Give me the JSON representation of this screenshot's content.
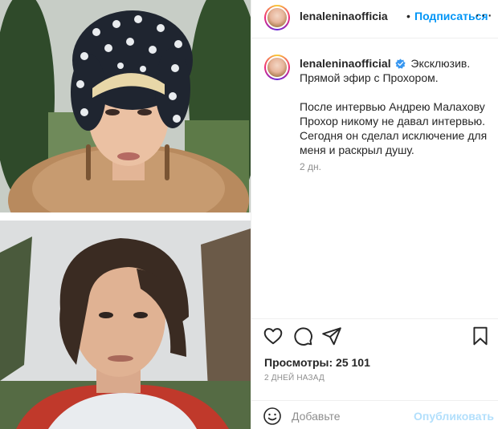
{
  "post": {
    "media_top_alt": "woman in polka-dot turban and fur coat",
    "media_bottom_alt": "man with dark fringe hair outdoors"
  },
  "header": {
    "username": "lenaleninaofficia",
    "dot": "•",
    "follow_label": "Подписаться",
    "more_label": "···"
  },
  "caption": {
    "username": "lenaleninaofficial",
    "line1": "Эксклюзив.",
    "line2": "Прямой эфир с Прохором.",
    "para2_line1": "После интервью Андрею Малахову",
    "para2_line2": "Прохор никому не давал интервью.",
    "para2_line3": "Сегодня он сделал исключение для",
    "para2_line4": "меня и раскрыл душу.",
    "time_ago": "2 дн."
  },
  "stats": {
    "views": "Просмотры: 25 101",
    "date": "2 ДНЕЙ НАЗАД"
  },
  "comment": {
    "placeholder": "Добавьте",
    "publish_label": "Опубликовать"
  },
  "colors": {
    "accent": "#0095f6",
    "publish_disabled": "#b2dffc",
    "secondary_text": "#8e8e8e",
    "border": "#efefef"
  },
  "icons": {
    "like": "heart-icon",
    "comment": "comment-icon",
    "share": "share-icon",
    "save": "bookmark-icon",
    "emoji": "smiley-icon",
    "verified": "verified-badge-icon",
    "more": "more-options-icon"
  }
}
